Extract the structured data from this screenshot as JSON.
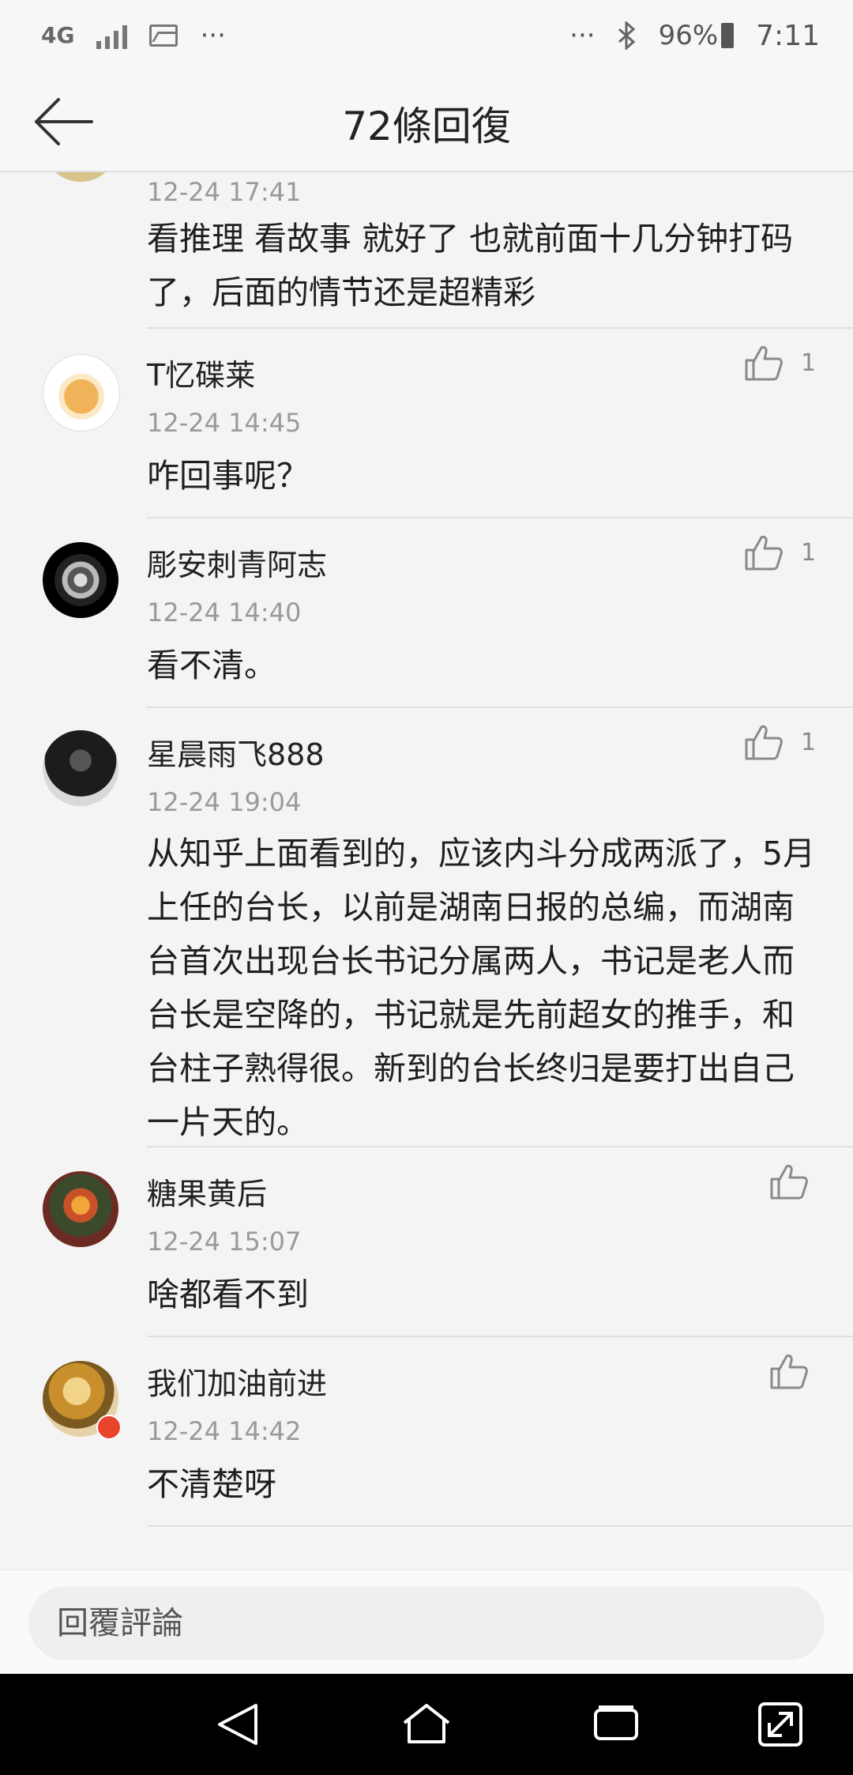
{
  "status_bar": {
    "network": "4G",
    "battery": "96%",
    "time": "7:11",
    "left_more": "···",
    "right_more": "···",
    "icons": [
      "signal-icon",
      "image-icon",
      "bluetooth-icon",
      "battery-icon"
    ]
  },
  "header": {
    "title": "72條回復",
    "back_icon": "arrow-left-icon"
  },
  "comments": [
    {
      "name": "",
      "date": "12-24 17:41",
      "text": "看推理 看故事 就好了 也就前面十几分钟打码了，后面的情节还是超精彩",
      "likes": ""
    },
    {
      "name": "T忆碟莱",
      "date": "12-24 14:45",
      "text": "咋回事呢？",
      "likes": "1"
    },
    {
      "name": "彫安刺青阿志",
      "date": "12-24 14:40",
      "text": "看不清。",
      "likes": "1"
    },
    {
      "name": "星晨雨飞888",
      "date": "12-24 19:04",
      "text": "从知乎上面看到的，应该内斗分成两派了，5月上任的台长，以前是湖南日报的总编，而湖南台首次出现台长书记分属两人，书记是老人而台长是空降的，书记就是先前超女的推手，和台柱子熟得很。新到的台长终归是要打出自己一片天的。",
      "likes": "1"
    },
    {
      "name": "糖果黄后",
      "date": "12-24 15:07",
      "text": "啥都看不到",
      "likes": ""
    },
    {
      "name": "我们加油前进",
      "date": "12-24 14:42",
      "text": "不清楚呀",
      "likes": ""
    }
  ],
  "reply": {
    "placeholder": "回覆評論"
  },
  "nav": {
    "icons": [
      "back-nav-icon",
      "home-nav-icon",
      "recents-nav-icon",
      "expand-nav-icon"
    ]
  },
  "colors": {
    "background": "#f4f4f4",
    "divider": "#e0e0e0",
    "date": "#9a9a9a",
    "nav": "#000000"
  }
}
